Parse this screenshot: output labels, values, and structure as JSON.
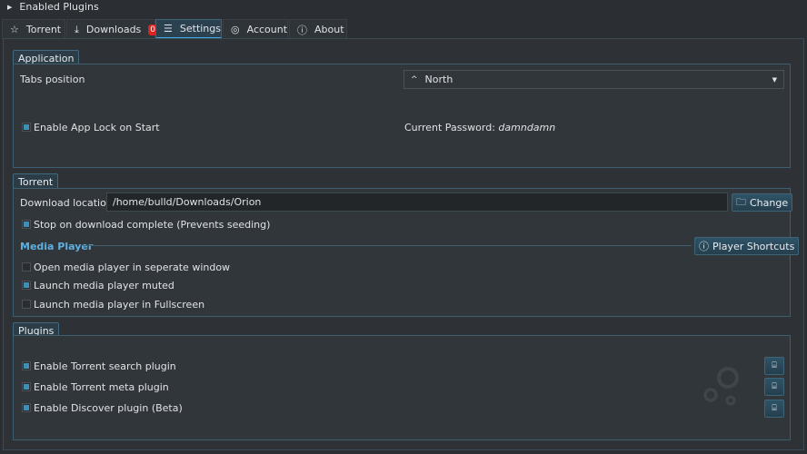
{
  "plugins_toggle": "Enabled Plugins",
  "tabs": [
    {
      "label": "Torrent",
      "icon": "torrent-icon"
    },
    {
      "label": "Downloads",
      "icon": "download-icon",
      "badge": "0"
    },
    {
      "label": "Settings",
      "icon": "sliders-icon"
    },
    {
      "label": "Account",
      "icon": "user-icon"
    },
    {
      "label": "About",
      "icon": "info-icon"
    }
  ],
  "application": {
    "title": "Application",
    "tabs_position_label": "Tabs position",
    "tabs_position_value": "North",
    "app_lock_label": "Enable App Lock on Start",
    "password_label": "Current Password:",
    "password_value": "damndamn"
  },
  "torrent": {
    "title": "Torrent",
    "download_location_label": "Download location :",
    "download_location_value": "/home/bulld/Downloads/Orion",
    "change_button": "Change",
    "stop_on_complete": "Stop on download complete (Prevents seeding)",
    "media_player_title": "Media Player",
    "player_shortcuts_button": "Player Shortcuts",
    "options": [
      {
        "label": "Open media player in seperate window",
        "checked": false
      },
      {
        "label": "Launch media player muted",
        "checked": true
      },
      {
        "label": "Launch media player in Fullscreen",
        "checked": false
      }
    ]
  },
  "plugins": {
    "title": "Plugins",
    "items": [
      {
        "label": "Enable Torrent search plugin",
        "checked": true
      },
      {
        "label": "Enable Torrent meta plugin",
        "checked": true
      },
      {
        "label": "Enable Discover plugin (Beta)",
        "checked": true
      }
    ]
  }
}
